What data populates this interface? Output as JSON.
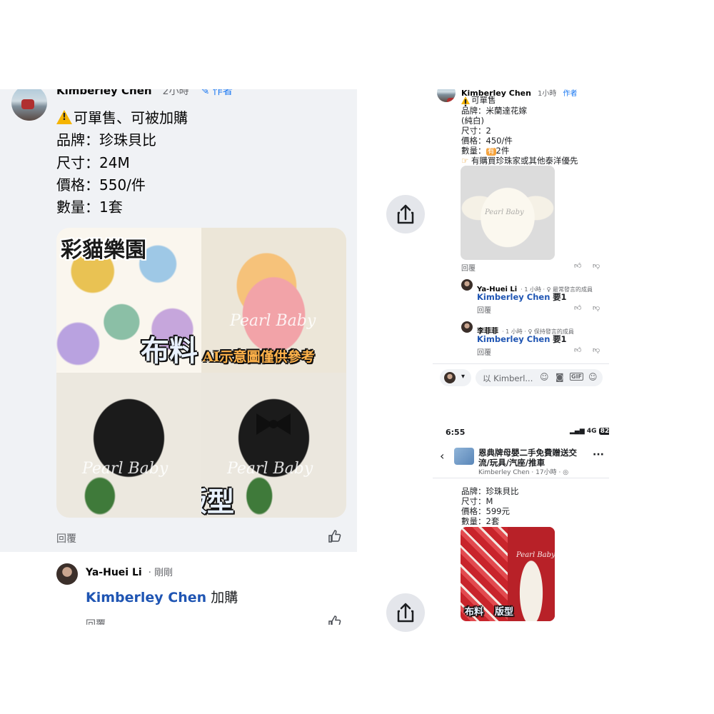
{
  "left_post": {
    "author": "Kimberley Chen",
    "time": "2小時",
    "author_badge": "作者",
    "lines": [
      "可單售、可被加購",
      "品牌：珍珠貝比",
      "尺寸：24M",
      "價格：550/件",
      "數量：1套"
    ],
    "image_text": {
      "top_left_label": "彩貓樂園",
      "fabric_label": "布料",
      "ai_note": "AI示意圖僅供參考",
      "pattern_label": "版型",
      "watermark": "Pearl Baby"
    },
    "reply_label": "回覆"
  },
  "left_comment": {
    "author": "Ya-Huei Li",
    "time": "剛剛",
    "mention": "Kimberley Chen",
    "text": "加購",
    "reply_label": "回覆"
  },
  "right_top": {
    "author": "Kimberley Chen",
    "time": "1小時",
    "author_badge": "作者",
    "lines": [
      "可單售",
      "品牌：米蘭達花嫁",
      "(純白)",
      "尺寸：2",
      "價格：450/件"
    ],
    "qty_prefix": "數量：",
    "qty_badge": "有",
    "qty_suffix": "2件",
    "priority_note": "有購買珍珠家或其他泰洋優先",
    "image_watermark": "Pearl Baby",
    "reply_label": "回覆",
    "comments": [
      {
        "author": "Ya-Huei Li",
        "meta": "· 1 小時 · ♀ 最常發言的成員",
        "mention": "Kimberley Chen",
        "text": "要1",
        "reply_label": "回覆"
      },
      {
        "author": "李菲菲",
        "meta": "· 1 小時 · ♀ 保持發言的成員",
        "mention": "Kimberley Chen",
        "text": "要1",
        "reply_label": "回覆"
      }
    ],
    "composer_placeholder": "以 Kimberl..."
  },
  "right_bottom": {
    "status_time": "6:55",
    "network": "4G",
    "battery": "82",
    "group_title_line1": "恩典牌母嬰二手免費贈送交",
    "group_title_line2": "流/玩具/汽座/推車",
    "group_meta": "Kimberley Chen · 17小時 · ◎",
    "lines": [
      "品牌：珍珠貝比",
      "尺寸：M",
      "價格：599元",
      "數量：2套"
    ],
    "image_text": {
      "watermark": "Pearl Baby",
      "fabric_label": "布料",
      "pattern_label": "版型"
    }
  },
  "colors": {
    "mention_blue": "#1f55b3",
    "panel_gray": "#f0f2f5",
    "warn_yellow": "#f5b400"
  },
  "icons": [
    "share-icon",
    "like-icon",
    "dislike-icon",
    "back-arrow-icon",
    "more-icon",
    "camera-icon",
    "gif-icon",
    "emoji-icon",
    "sticker-icon",
    "warning-icon",
    "pointing-hand-icon"
  ]
}
